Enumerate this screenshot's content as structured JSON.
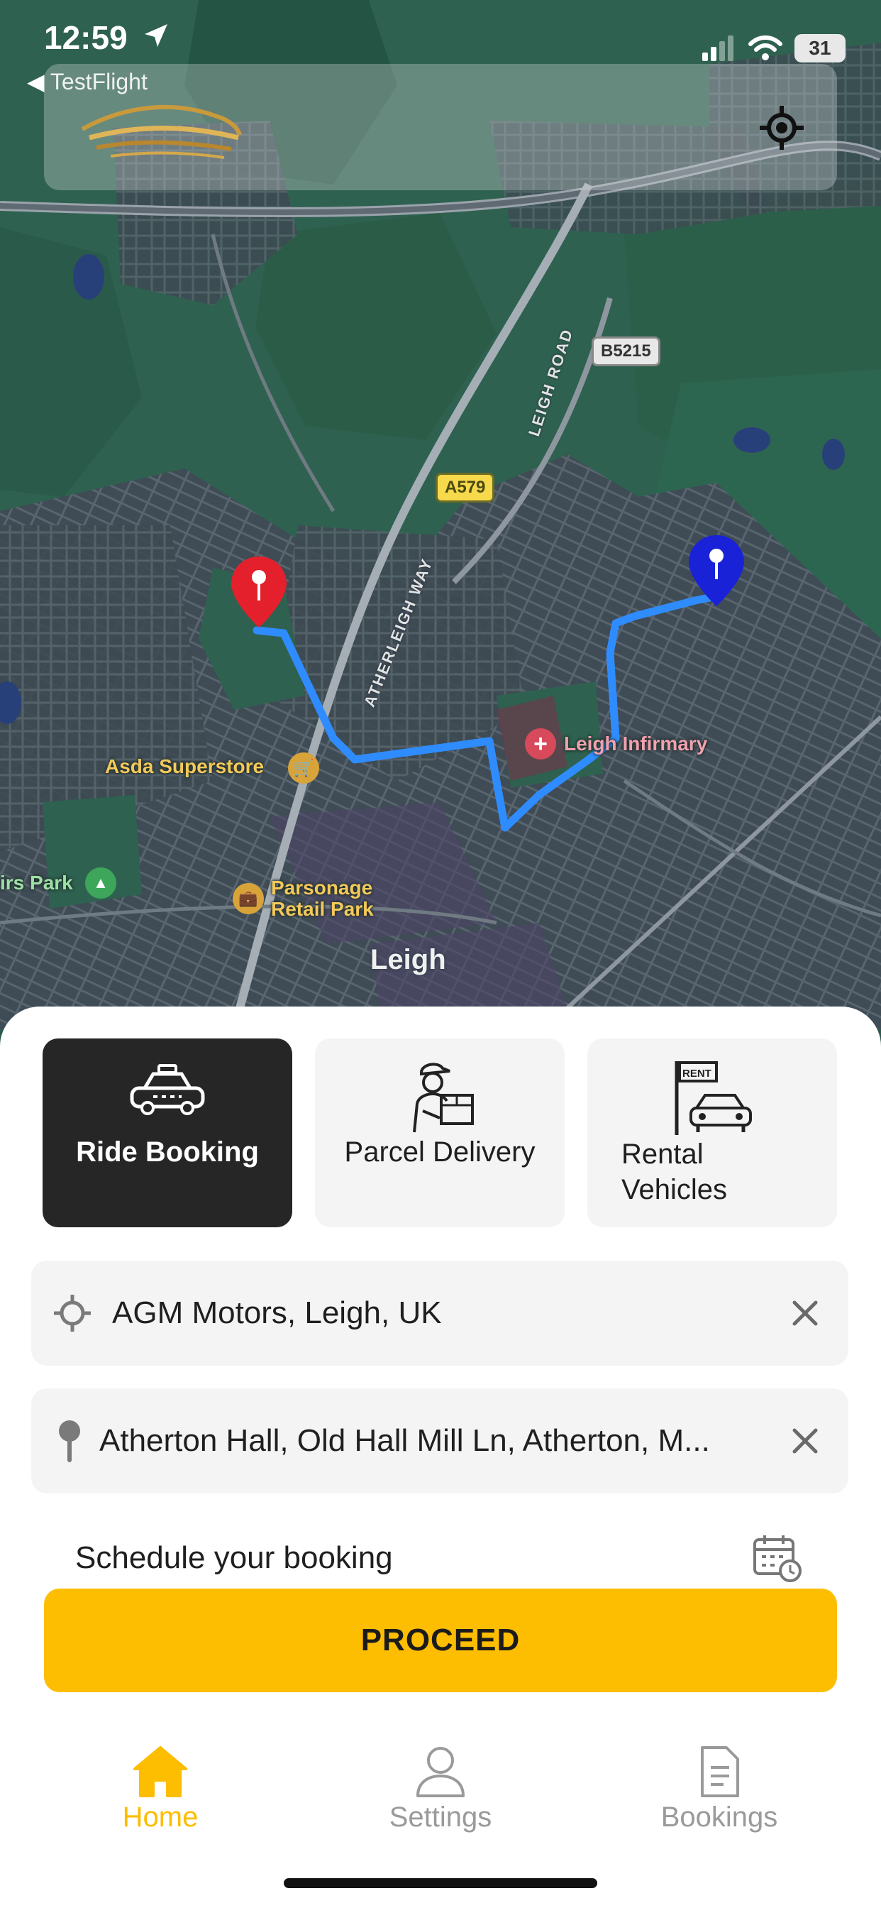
{
  "status_bar": {
    "time": "12:59",
    "back_app": "TestFlight",
    "battery": "31"
  },
  "map": {
    "road_shields": [
      "B5215",
      "A579"
    ],
    "road_names": [
      "LEIGH ROAD",
      "ATHERLEIGH WAY"
    ],
    "pois": {
      "asda": "Asda Superstore",
      "infirmary": "Leigh Infirmary",
      "parsonage_line1": "Parsonage",
      "parsonage_line2": "Retail Park",
      "park": "irs Park"
    },
    "town": "Leigh",
    "route_color": "#2f8cff",
    "pickup_pin_color": "#e3202c",
    "dropoff_pin_color": "#1a22d8"
  },
  "services": [
    {
      "label": "Ride Booking",
      "icon": "taxi-icon",
      "active": true
    },
    {
      "label": "Parcel Delivery",
      "icon": "delivery-person-icon",
      "active": false
    },
    {
      "label": "Rental\nVehicles",
      "icon": "rent-car-icon",
      "active": false
    }
  ],
  "pickup": {
    "value": "AGM Motors, Leigh, UK",
    "icon": "crosshair-icon"
  },
  "dropoff": {
    "value": "Atherton Hall, Old Hall Mill Ln, Atherton, M...",
    "icon": "pin-icon"
  },
  "schedule": {
    "label": "Schedule your booking",
    "icon": "calendar-clock-icon"
  },
  "proceed_label": "PROCEED",
  "tabs": [
    {
      "label": "Home",
      "icon": "home-icon",
      "active": true
    },
    {
      "label": "Settings",
      "icon": "person-icon",
      "active": false
    },
    {
      "label": "Bookings",
      "icon": "document-icon",
      "active": false
    }
  ],
  "colors": {
    "accent": "#fdbd00",
    "active_card": "#262626",
    "card_bg": "#f4f4f4"
  }
}
